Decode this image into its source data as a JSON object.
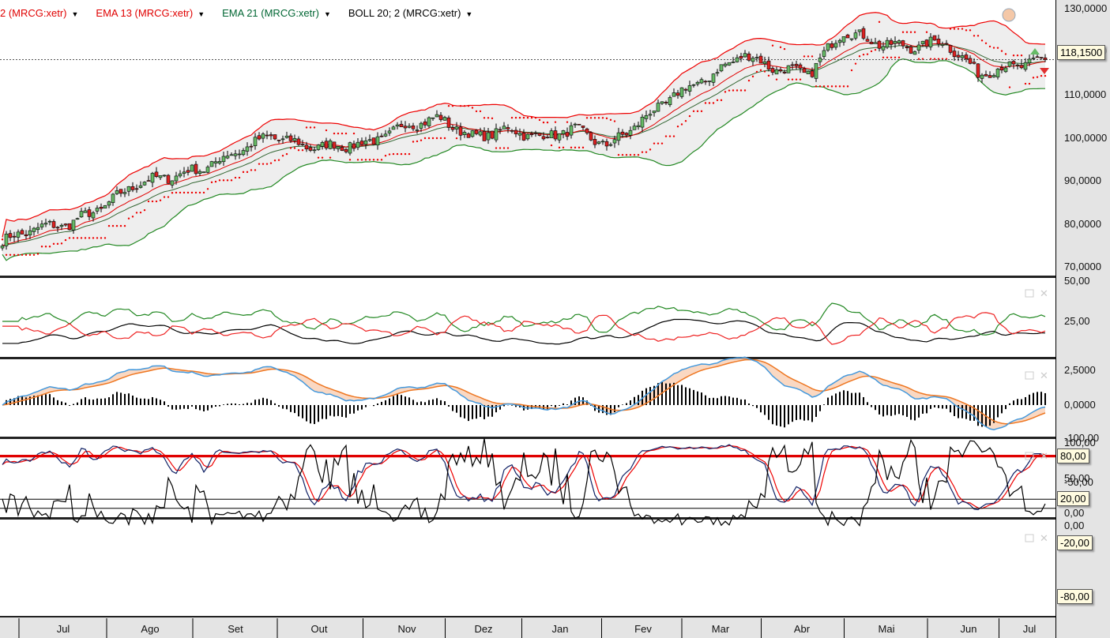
{
  "legend": [
    {
      "label": "2 (MRCG:xetr)",
      "color": "#e00000"
    },
    {
      "label": "EMA 13 (MRCG:xetr)",
      "color": "#e00000"
    },
    {
      "label": "EMA 21 (MRCG:xetr)",
      "color": "#006633"
    },
    {
      "label": "BOLL 20; 2 (MRCG:xetr)",
      "color": "#000000"
    }
  ],
  "current_price_tag": "118,1500",
  "panels": {
    "price": {
      "ticks": [
        "130,0000",
        "120,0000",
        "110,0000",
        "100,0000",
        "90,0000",
        "80,0000",
        "70,0000"
      ],
      "tick_values": [
        130,
        120,
        110,
        100,
        90,
        80,
        70
      ]
    },
    "adx": {
      "ticks": [
        "50,00",
        "25,00"
      ],
      "tick_values": [
        50,
        25
      ]
    },
    "macd": {
      "ticks": [
        "2,5000",
        "0,0000"
      ],
      "tick_values": [
        2.5,
        0
      ]
    },
    "stoch": {
      "ticks": [
        "100,00",
        "50,00",
        "0,00"
      ],
      "tick_values": [
        100,
        50,
        0
      ],
      "tags": [
        "80,00",
        "20,00"
      ]
    },
    "williams": {
      "ticks": [
        "0,00",
        "-50,00",
        "-100,00"
      ],
      "tick_values": [
        0,
        -50,
        -100
      ],
      "tags": [
        "-20,00",
        "-80,00"
      ]
    }
  },
  "chart_data": {
    "type": "candlestick",
    "symbol": "MRCG:xetr",
    "months": [
      "Jul",
      "Ago",
      "Set",
      "Out",
      "Nov",
      "Dez",
      "Jan",
      "Fev",
      "Mar",
      "Abr",
      "Mai",
      "Jun",
      "Jul"
    ],
    "close_anchors": [
      76,
      79,
      80,
      84,
      89.5,
      91,
      93,
      97,
      100.5,
      98,
      98,
      99,
      103,
      104.5,
      100,
      102,
      100,
      102,
      98,
      104,
      110,
      114,
      119.5,
      116,
      115,
      125,
      122,
      121,
      122.5,
      115,
      116.5,
      118.15
    ],
    "ylim": [
      68,
      132
    ],
    "colors": {
      "up": "#66bb66",
      "down": "#dd2222",
      "ema13": "#e00000",
      "ema21": "#336633",
      "boll_up": "#ee0000",
      "boll_low": "#228822",
      "sar": "#ee0000",
      "di_plus": "#228822",
      "di_minus": "#ee2222",
      "adx": "#000000",
      "macd": "#4499dd",
      "signal": "#ee7722",
      "stoch_k": "#112266",
      "stoch_d": "#ee0000"
    }
  }
}
